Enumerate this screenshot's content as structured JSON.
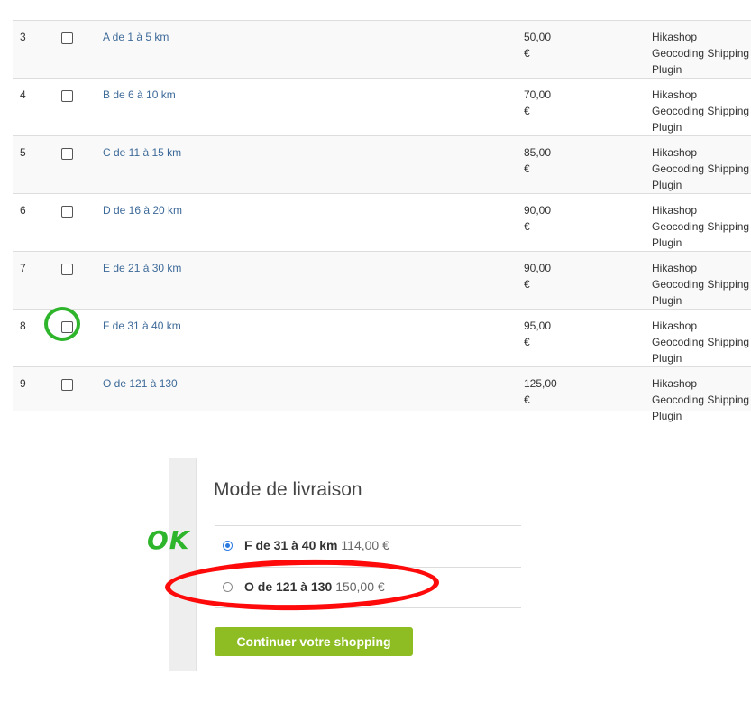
{
  "shipping_table": {
    "rows": [
      {
        "num": "3",
        "name": "A de 1 à 5 km",
        "price": "50,00\n€",
        "plugin": "Hikashop Geocoding Shipping Plugin"
      },
      {
        "num": "4",
        "name": "B de 6 à 10 km",
        "price": "70,00\n€",
        "plugin": "Hikashop Geocoding Shipping Plugin"
      },
      {
        "num": "5",
        "name": "C de 11 à 15 km",
        "price": "85,00\n€",
        "plugin": "Hikashop Geocoding Shipping Plugin"
      },
      {
        "num": "6",
        "name": "D de 16 à 20 km",
        "price": "90,00\n€",
        "plugin": "Hikashop Geocoding Shipping Plugin"
      },
      {
        "num": "7",
        "name": "E de 21 à 30 km",
        "price": "90,00\n€",
        "plugin": "Hikashop Geocoding Shipping Plugin"
      },
      {
        "num": "8",
        "name": "F de 31 à 40 km",
        "price": "95,00\n€",
        "plugin": "Hikashop Geocoding Shipping Plugin"
      },
      {
        "num": "9",
        "name": "O de 121 à 130",
        "price": "125,00\n€",
        "plugin": "Hikashop Geocoding Shipping Plugin"
      }
    ]
  },
  "checkout": {
    "title": "Mode de livraison",
    "options": [
      {
        "name": "F de 31 à 40 km",
        "price": "114,00 €",
        "selected": true
      },
      {
        "name": "O de 121 à 130",
        "price": "150,00 €",
        "selected": false
      }
    ],
    "continue_label": "Continuer votre shopping"
  },
  "annotations": {
    "ok_text": "OK",
    "green": "#2fb52c",
    "red": "#ff0a0a"
  },
  "colors": {
    "link": "#3d6a99",
    "button": "#8dbd22",
    "radio_selected": "#2a7ae2"
  }
}
